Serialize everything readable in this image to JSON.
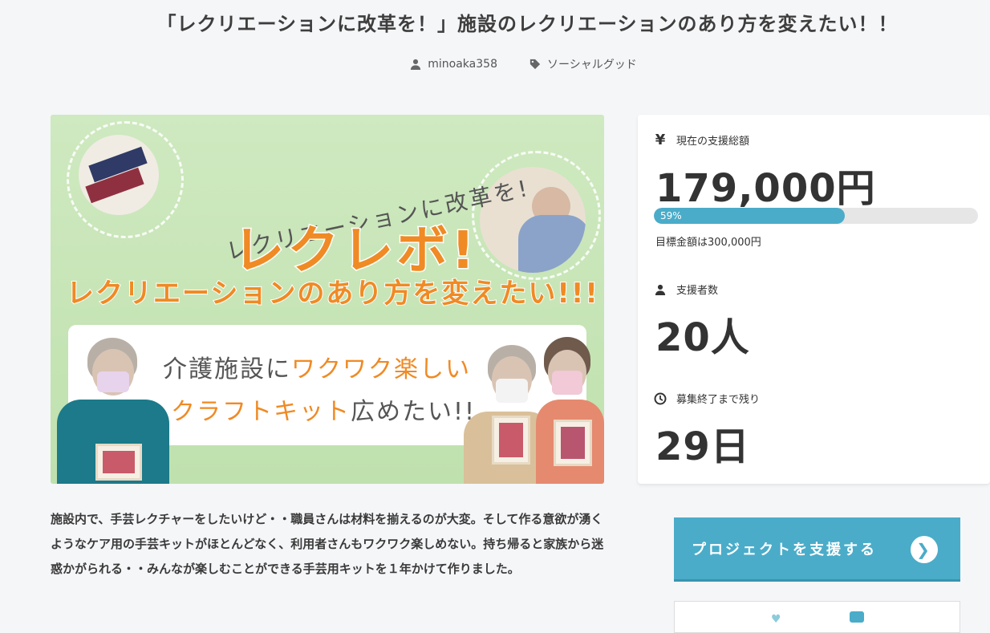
{
  "title": "「レクリエーションに改革を！」施設のレクリエーションのあり方を変えたい！！",
  "meta": {
    "author": "minoaka358",
    "category": "ソーシャルグッド"
  },
  "hero": {
    "line1": "レクリエーションに改革を!",
    "line2": "レクレボ!",
    "line3": "レクリエーションのあり方を変えたい!!!",
    "panel_line1_a": "介護施設に",
    "panel_line1_b": "ワクワク楽しい",
    "panel_line2_a": "クラフトキット",
    "panel_line2_b": "広めたい!!"
  },
  "description": "施設内で、手芸レクチャーをしたいけど・・職員さんは材料を揃えるのが大変。そして作る意欲が湧くようなケア用の手芸キットがほとんどなく、利用者さんもワクワク楽しめない。持ち帰ると家族から迷惑かがられる・・みんなが楽しむことができる手芸用キットを１年かけて作りました。",
  "stats": {
    "total_label": "現在の支援総額",
    "total_value": "179,000円",
    "progress_percent": 59,
    "progress_text": "59%",
    "goal_text": "目標金額は300,000円",
    "supporters_label": "支援者数",
    "supporters_value": "20人",
    "remaining_label": "募集終了まで残り",
    "remaining_value": "29日"
  },
  "icons": {
    "yen": "¥"
  },
  "cta": {
    "label": "プロジェクトを支援する",
    "arrow": "❯"
  },
  "colors": {
    "accent": "#4aacc9",
    "orange": "#f08a24"
  }
}
